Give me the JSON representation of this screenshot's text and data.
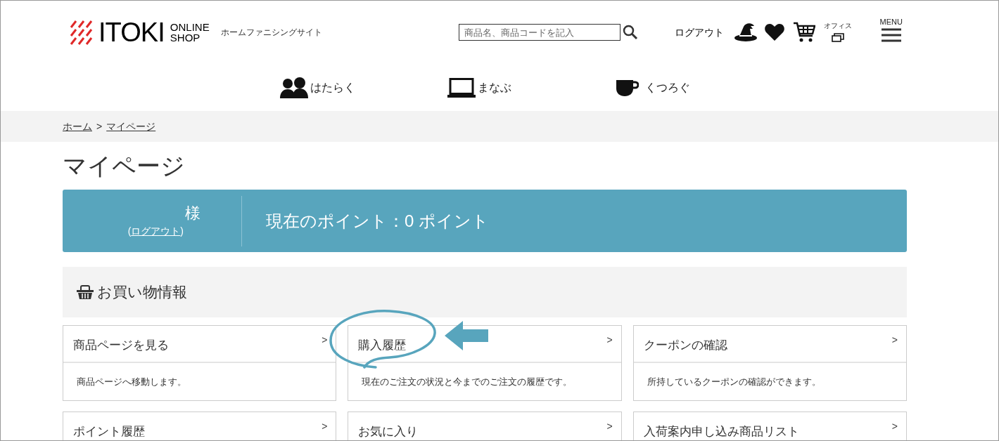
{
  "header": {
    "logo": {
      "brand": "ITOKI",
      "line_1": "ONLINE",
      "line_2": "SHOP"
    },
    "tagline": "ホームファニシングサイト",
    "search": {
      "placeholder": "商品名、商品コードを記入"
    },
    "logout": "ログアウト",
    "office_label": "オフィス",
    "menu_label": "MENU"
  },
  "nav": [
    {
      "kind": "people",
      "label": "はたらく"
    },
    {
      "kind": "laptop",
      "label": "まなぶ"
    },
    {
      "kind": "cup",
      "label": "くつろぐ"
    }
  ],
  "breadcrumb": [
    {
      "label": "ホーム"
    },
    {
      "label": "マイページ"
    }
  ],
  "breadcrumb_separator": ">",
  "page_title": "マイページ",
  "member": {
    "honorific": "様",
    "logout_open": "(",
    "logout": "ログアウト",
    "logout_close": ")",
    "points": "現在のポイント：0 ポイント"
  },
  "section": {
    "title": "お買い物情報"
  },
  "cards": [
    {
      "title": "商品ページを見る",
      "description": "商品ページへ移動します。",
      "highlighted": false
    },
    {
      "title": "購入履歴",
      "description": "現在のご注文の状況と今までのご注文の履歴です。",
      "highlighted": true
    },
    {
      "title": "クーポンの確認",
      "description": "所持しているクーポンの確認ができます。",
      "highlighted": false
    },
    {
      "title": "ポイント履歴",
      "highlighted": false
    },
    {
      "title": "お気に入り",
      "highlighted": false
    },
    {
      "title": "入荷案内申し込み商品リスト",
      "highlighted": false
    }
  ],
  "chevron": ">"
}
